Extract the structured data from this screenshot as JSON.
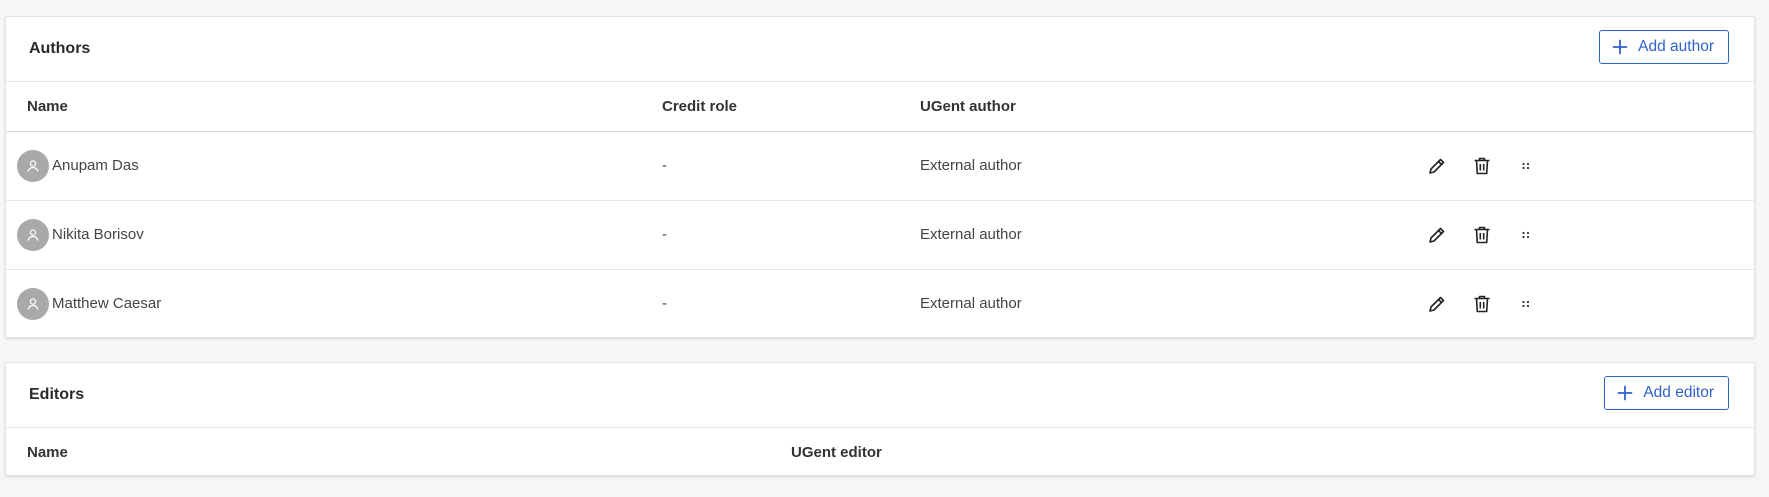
{
  "authors": {
    "title": "Authors",
    "add_button_label": "Add author",
    "columns": {
      "name": "Name",
      "credit_role": "Credit role",
      "ugent_author": "UGent author"
    },
    "rows": [
      {
        "name": "Anupam Das",
        "credit_role": "-",
        "ugent_author": "External author"
      },
      {
        "name": "Nikita Borisov",
        "credit_role": "-",
        "ugent_author": "External author"
      },
      {
        "name": "Matthew Caesar",
        "credit_role": "-",
        "ugent_author": "External author"
      }
    ],
    "row_actions": [
      "pencil-icon",
      "trash-icon",
      "drag-handle-icon"
    ]
  },
  "editors": {
    "title": "Editors",
    "add_button_label": "Add editor",
    "columns": {
      "name": "Name",
      "ugent_editor": "UGent editor"
    }
  },
  "colors": {
    "accent": "#2f63c8",
    "avatar": "#a9a9a9",
    "background": "#f6f6f6"
  }
}
